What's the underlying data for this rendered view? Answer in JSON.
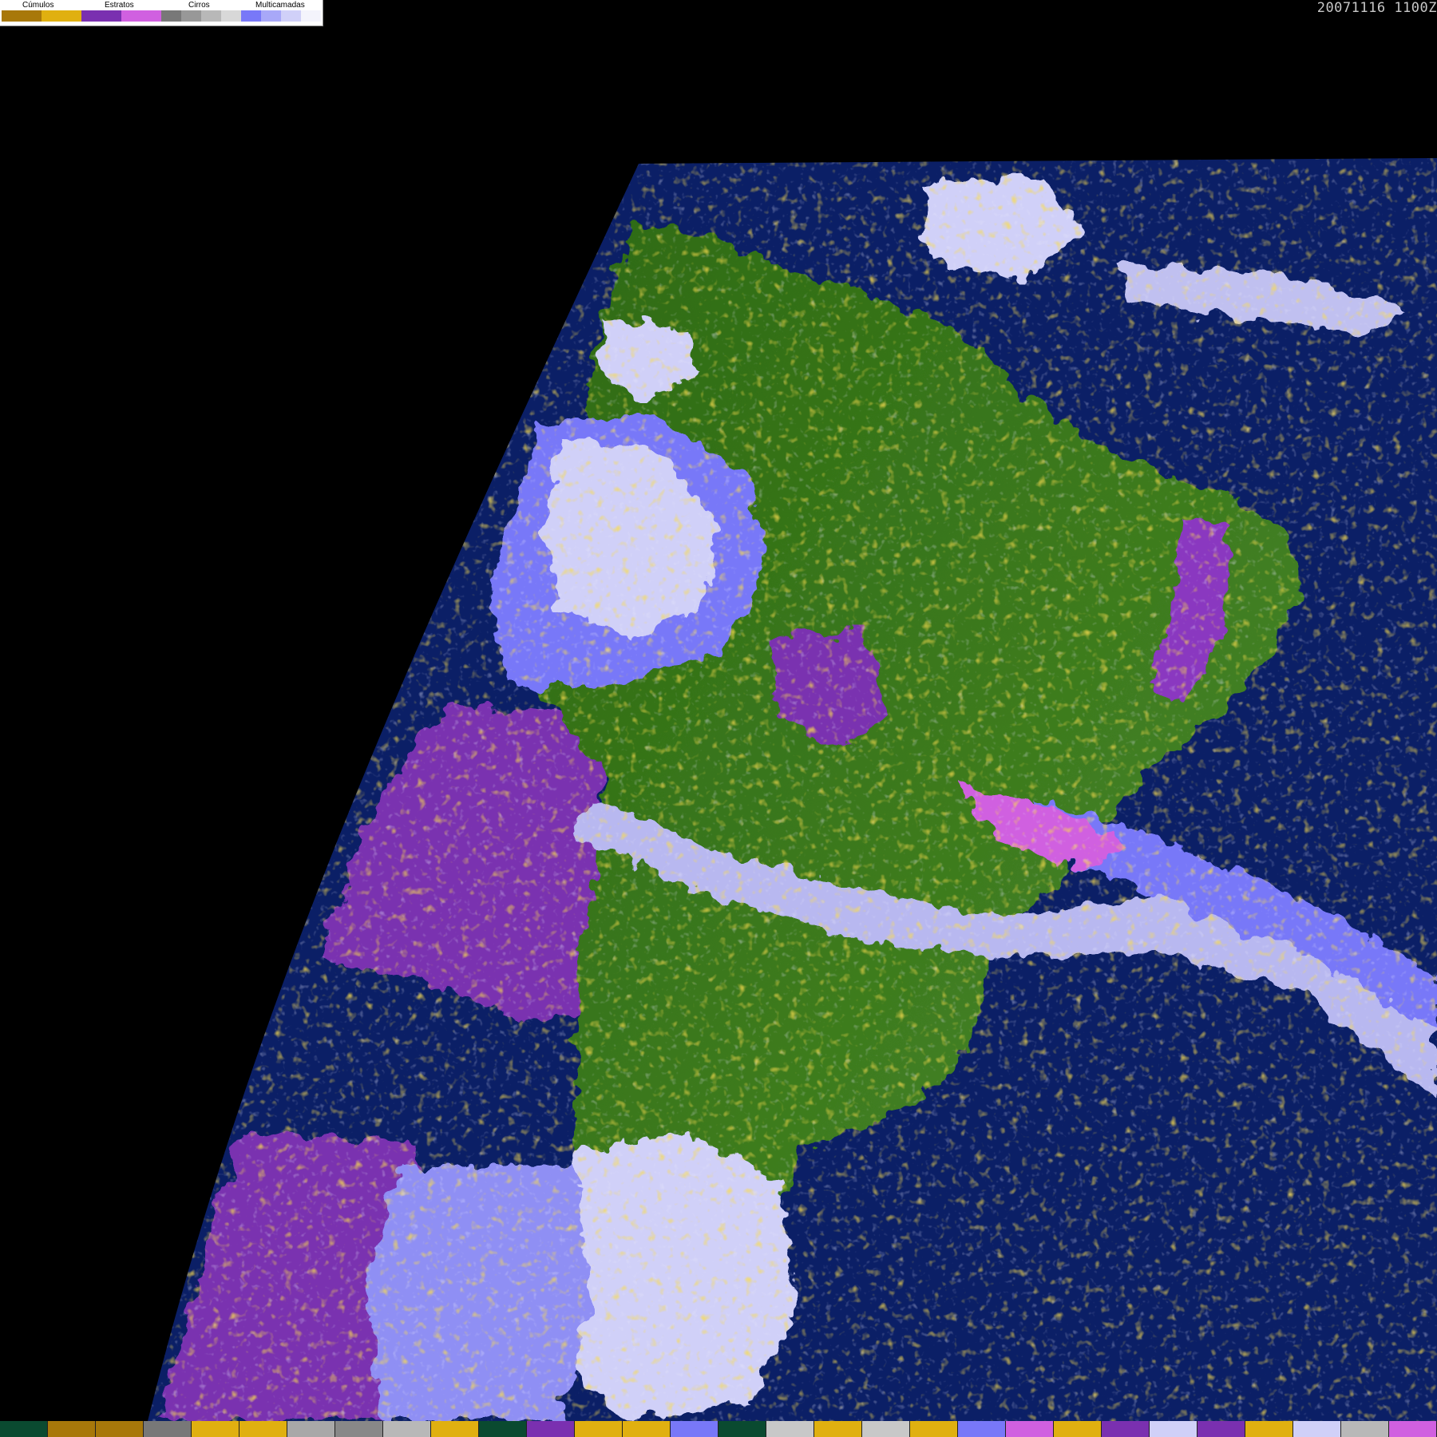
{
  "legend": {
    "labels": [
      "Cúmulos",
      "Estratos",
      "Cirros",
      "Multicamadas"
    ],
    "swatches": [
      "#a8780a",
      "#e0b010",
      "#7a30b0",
      "#d060e0",
      "#787878",
      "#989898",
      "#b8b8b8",
      "#d8d8d8",
      "#7878f8",
      "#a8a8f8",
      "#d0d0f8",
      "#f4f4fc"
    ]
  },
  "timestamp": "20071116 1100Z",
  "colors": {
    "background": "#000000",
    "ocean": "#0b1f66",
    "land_forest": "#2d6a12",
    "land_open": "#4d8a2a",
    "cumulus_low": "#a8780a",
    "cumulus_high": "#e0b010",
    "stratus_low": "#7a30b0",
    "stratus_high": "#d060e0",
    "cirrus": "#b8b8b8",
    "multilayer": "#7878f8",
    "multilayer_dense": "#d0d0f8"
  },
  "bottom_bar": [
    "#0a4a30",
    "#a8780a",
    "#a8780a",
    "#787878",
    "#e0b010",
    "#e0b010",
    "#a8a8a8",
    "#888888",
    "#b8b8b8",
    "#e0b010",
    "#0a4a30",
    "#7a30b0",
    "#e0b010",
    "#e0b010",
    "#7878f8",
    "#0a4a30",
    "#c8c8c8",
    "#e0b010",
    "#c8c8c8",
    "#e0b010",
    "#7878f8",
    "#d060e0",
    "#e0b010",
    "#7a30b0",
    "#d0d0f8",
    "#7a30b0",
    "#e0b010",
    "#d0d0f8",
    "#b8b8b8",
    "#d060e0"
  ]
}
